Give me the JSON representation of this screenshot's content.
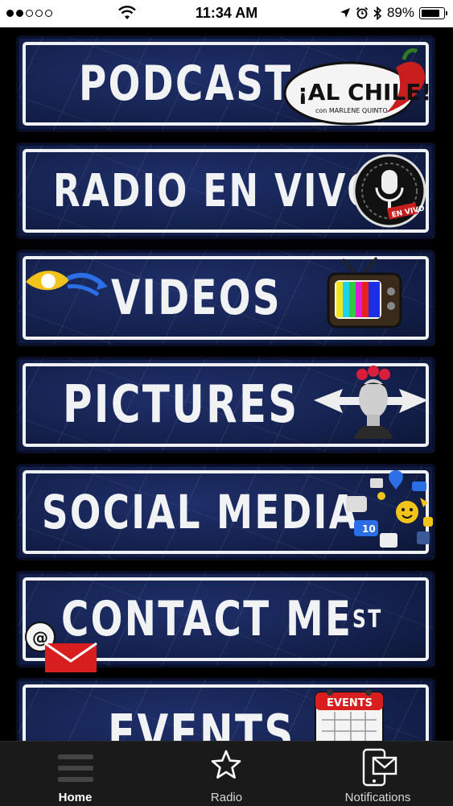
{
  "status_bar": {
    "time": "11:34 AM",
    "battery": "89%",
    "battery_level": 0.89,
    "signal_dots_filled": 2,
    "signal_dots_total": 5
  },
  "menu": {
    "items": [
      {
        "label": "PODCAST",
        "badge": "¡AL CHILE!",
        "badge_sub": "con MARLENE QUINTO"
      },
      {
        "label": "RADIO EN VIVO",
        "badge": "EN VIVO"
      },
      {
        "label": "VIDEOS"
      },
      {
        "label": "PICTURES"
      },
      {
        "label": "SOCIAL MEDIA",
        "badge": "10"
      },
      {
        "label": "CONTACT ME",
        "suffix": "ST",
        "badge": "@"
      },
      {
        "label": "EVENTS",
        "badge": "EVENTS"
      }
    ]
  },
  "tabbar": {
    "tabs": [
      {
        "label": "Home",
        "icon": "hamburger-icon",
        "active": true
      },
      {
        "label": "Radio",
        "icon": "star-icon",
        "active": false
      },
      {
        "label": "Notifications",
        "icon": "phone-envelope-icon",
        "active": false
      }
    ]
  },
  "colors": {
    "sign_blue": "#15224f",
    "sign_border": "#eef0f4",
    "tabbar_bg": "#1a1a1a",
    "chili_red": "#c81e1e"
  }
}
